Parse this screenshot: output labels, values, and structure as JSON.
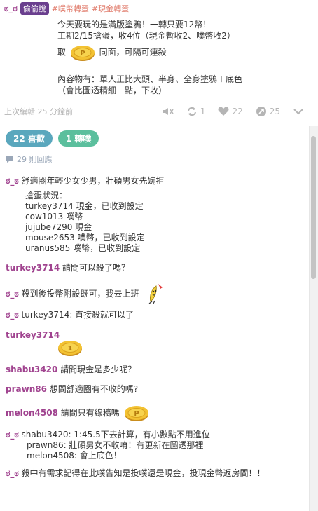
{
  "post": {
    "author": "ಠ_ಠ",
    "tag": "偷偷說",
    "hashtags": [
      "#噗幣轉蛋",
      "#現金轉蛋"
    ],
    "lines": [
      "今天要玩的是滿版塗鴉！一轉只要12幣！",
      "工期2/15搶蛋，收4位（",
      "、噗幣收2）",
      "取",
      "同面，可隔可連殺",
      "內容物有：單人正比大頭、半身、全身塗鴉＋底色",
      "（會比圖透精細一點，下收）"
    ],
    "strike_text": "現金暫收2",
    "edited": "上次編輯 25 分鐘前",
    "stats": {
      "replurk": "1",
      "likes": "22",
      "reposts": "25"
    }
  },
  "pills": {
    "likes": "22 喜歡",
    "replurks": "1 轉噗"
  },
  "reply_count": "29 則回應",
  "comments": [
    {
      "who": "ಠ_ಠ",
      "text": "舒適圈年輕少女少男，壯碩男女先婉拒"
    },
    {
      "list": [
        "搶蛋狀況：",
        "turkey3714 現金，已收到設定",
        "cow1013 噗幣",
        "jujube7290 現金",
        "mouse2653 噗幣，已收到設定",
        "uranus585 噗幣，已收到設定"
      ]
    },
    {
      "who": "turkey3714",
      "text": "請問可以殺了嗎？"
    },
    {
      "who": "ಠ_ಠ",
      "text": "殺到後投幣附設既可，我去上班"
    },
    {
      "who": "ಠ_ಠ",
      "text": "turkey3714: 直接殺就可以了"
    },
    {
      "who": "turkey3714",
      "text": ""
    },
    {
      "who": "shabu3420",
      "text": "請問現金是多少呢？"
    },
    {
      "who": "prawn86",
      "text": "想問舒適圈有不收的嗎?"
    },
    {
      "who": "melon4508",
      "text": "請問只有線稿嗎"
    },
    {
      "who": "ಠ_ಠ",
      "text": "shabu3420: 1:45.5下去計算，有小數點不用進位"
    },
    {
      "list": [
        "prawn86: 壯碩男女不收唷！有更新在圖透那裡",
        "melon4508: 會上底色！"
      ]
    },
    {
      "who": "ಠ_ಠ",
      "text": "殺中有需求記得在此噗告知是投噗還是現金，投現金幣返房間！！"
    }
  ],
  "colors": {
    "accent": "#a0438f",
    "tag": "#6a3f8e",
    "pill_blue": "#5aa7bd",
    "pill_teal": "#5bbf9d",
    "hashtag": "#e07b6b"
  },
  "icons": [
    "mute-icon",
    "replurk-icon",
    "heart-icon",
    "repost-icon",
    "chevron-down-icon",
    "speech-bubble-icon",
    "coin-icon",
    "banana-sticker"
  ]
}
